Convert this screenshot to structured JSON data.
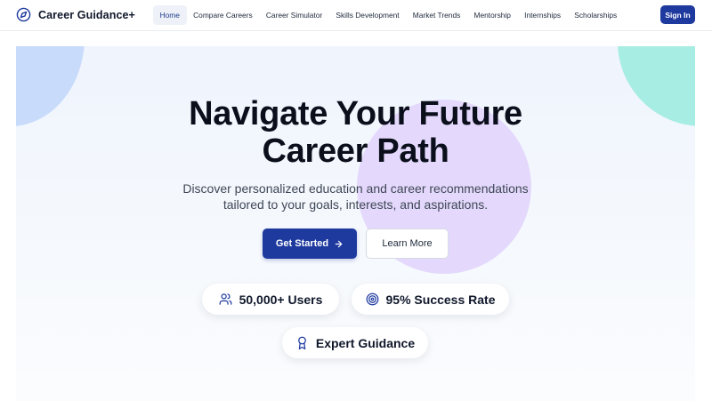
{
  "brand": {
    "name": "Career Guidance+",
    "icon": "compass-icon"
  },
  "nav": {
    "items": [
      {
        "label": "Home",
        "active": true
      },
      {
        "label": "Compare Careers"
      },
      {
        "label": "Career Simulator"
      },
      {
        "label": "Skills Development"
      },
      {
        "label": "Market Trends"
      },
      {
        "label": "Mentorship"
      },
      {
        "label": "Internships"
      },
      {
        "label": "Scholarships"
      }
    ],
    "signin_label": "Sign In"
  },
  "hero": {
    "headline_line1": "Navigate Your Future",
    "headline_line2": "Career Path",
    "subtext_line1": "Discover personalized education and career recommendations",
    "subtext_line2": "tailored to your goals, interests, and aspirations.",
    "primary_cta": "Get Started",
    "secondary_cta": "Learn More"
  },
  "stats": [
    {
      "label": "50,000+ Users",
      "icon": "users-icon"
    },
    {
      "label": "95% Success Rate",
      "icon": "target-icon"
    },
    {
      "label": "Expert Guidance",
      "icon": "award-icon"
    }
  ],
  "colors": {
    "primary": "#1e3a9f",
    "accent_blue": "#c8dbfb",
    "accent_teal": "#a7ede4",
    "accent_purple": "#e4d9fc"
  }
}
